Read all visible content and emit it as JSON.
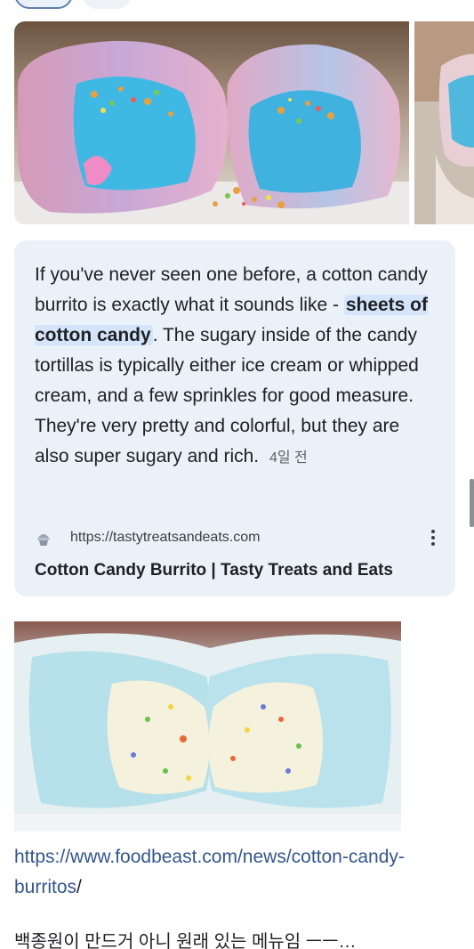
{
  "snippet": {
    "text_before": "If you've never seen one before, a cotton candy burrito is exactly what it sounds like - ",
    "highlight": "sheets of cotton candy",
    "text_after": ". The sugary inside of the candy tortillas is typically either ice cream or whipped cream, and a few sprinkles for good measure. They're very pretty and colorful, but they are also super sugary and rich.",
    "date": "4일 전"
  },
  "source": {
    "url": "https://tastytreatsandeats.com",
    "title": "Cotton Candy Burrito | Tasty Treats and Eats",
    "favicon": "cupcake-icon",
    "menu_icon": "more-vert-icon"
  },
  "link": {
    "text": "https://www.foodbeast.com/news/cotton-candy-burritos",
    "trailing": "/"
  },
  "comment": {
    "text": "백종원이 만드거 아니 원래 있는 메뉴임 ㅡㅡ…"
  },
  "colors": {
    "snippet_bg": "#eaf1f8",
    "highlight_bg": "#d4e4fb",
    "link": "#33568a"
  }
}
